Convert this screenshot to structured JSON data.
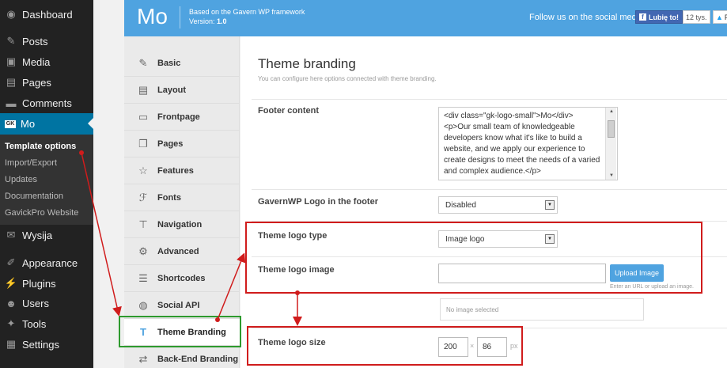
{
  "wp_sidebar": {
    "items": [
      {
        "label": "Dashboard",
        "icon": "dashboard-icon",
        "glyph": "◉"
      },
      {
        "label": "Posts",
        "icon": "pin-icon",
        "glyph": "✎"
      },
      {
        "label": "Media",
        "icon": "media-icon",
        "glyph": "▣"
      },
      {
        "label": "Pages",
        "icon": "pages-icon",
        "glyph": "▤"
      },
      {
        "label": "Comments",
        "icon": "comments-icon",
        "glyph": "▬"
      },
      {
        "label": "Mo",
        "icon": "gk-icon",
        "glyph": "GK"
      },
      {
        "label": "Wysija",
        "icon": "mail-icon",
        "glyph": "✉"
      },
      {
        "label": "Appearance",
        "icon": "paintbrush-icon",
        "glyph": "✐"
      },
      {
        "label": "Plugins",
        "icon": "plugin-icon",
        "glyph": "⚡"
      },
      {
        "label": "Users",
        "icon": "users-icon",
        "glyph": "☻"
      },
      {
        "label": "Tools",
        "icon": "wrench-icon",
        "glyph": "✦"
      },
      {
        "label": "Settings",
        "icon": "settings-icon",
        "glyph": "▦"
      }
    ],
    "submenu": [
      "Template options",
      "Import/Export",
      "Updates",
      "Documentation",
      "GavickPro Website"
    ]
  },
  "header": {
    "logo": "Mo",
    "based_on": "Based on the Gavern WP framework",
    "version_label": "Version: ",
    "version": "1.0",
    "follow_text": "Follow us on the social media:",
    "fb_like": "Lubię to!",
    "fb_count": "12 tys.",
    "tw_label": "F"
  },
  "nav": {
    "items": [
      {
        "label": "Basic",
        "icon": "pencil-icon",
        "glyph": "✎"
      },
      {
        "label": "Layout",
        "icon": "layout-icon",
        "glyph": "▤"
      },
      {
        "label": "Frontpage",
        "icon": "monitor-icon",
        "glyph": "▭"
      },
      {
        "label": "Pages",
        "icon": "pages-icon",
        "glyph": "❐"
      },
      {
        "label": "Features",
        "icon": "star-icon",
        "glyph": "☆"
      },
      {
        "label": "Fonts",
        "icon": "font-icon",
        "glyph": "ℱ"
      },
      {
        "label": "Navigation",
        "icon": "signpost-icon",
        "glyph": "⊤"
      },
      {
        "label": "Advanced",
        "icon": "gear-icon",
        "glyph": "⚙"
      },
      {
        "label": "Shortcodes",
        "icon": "list-icon",
        "glyph": "☰"
      },
      {
        "label": "Social API",
        "icon": "twitter-icon",
        "glyph": "◍"
      },
      {
        "label": "Theme Branding",
        "icon": "brush-icon",
        "glyph": "T"
      },
      {
        "label": "Back-End Branding",
        "icon": "swap-icon",
        "glyph": "⇄"
      }
    ]
  },
  "main": {
    "title": "Theme branding",
    "description": "You can configure here options connected with theme branding.",
    "footer_content_label": "Footer content",
    "footer_content_value": "<div class=\"gk-logo-small\">Mo</div>\n<p>Our small team of knowledgeable developers know what it's like to build a website, and we apply our experience to create designs to meet the needs of a varied and complex audience.</p>",
    "gavern_logo_label": "GavernWP Logo in the footer",
    "gavern_logo_value": "Disabled",
    "logo_type_label": "Theme logo type",
    "logo_type_value": "Image logo",
    "logo_image_label": "Theme logo image",
    "logo_image_value": "",
    "upload_button": "Upload Image",
    "upload_hint": "Enter an URL or upload an image.",
    "no_image": "No image selected",
    "logo_size_label": "Theme logo size",
    "logo_width": "200",
    "size_separator": "×",
    "logo_height": "86",
    "size_unit": "px"
  },
  "annotation_colors": {
    "red": "#d01c1c",
    "green": "#2e9a2e"
  }
}
